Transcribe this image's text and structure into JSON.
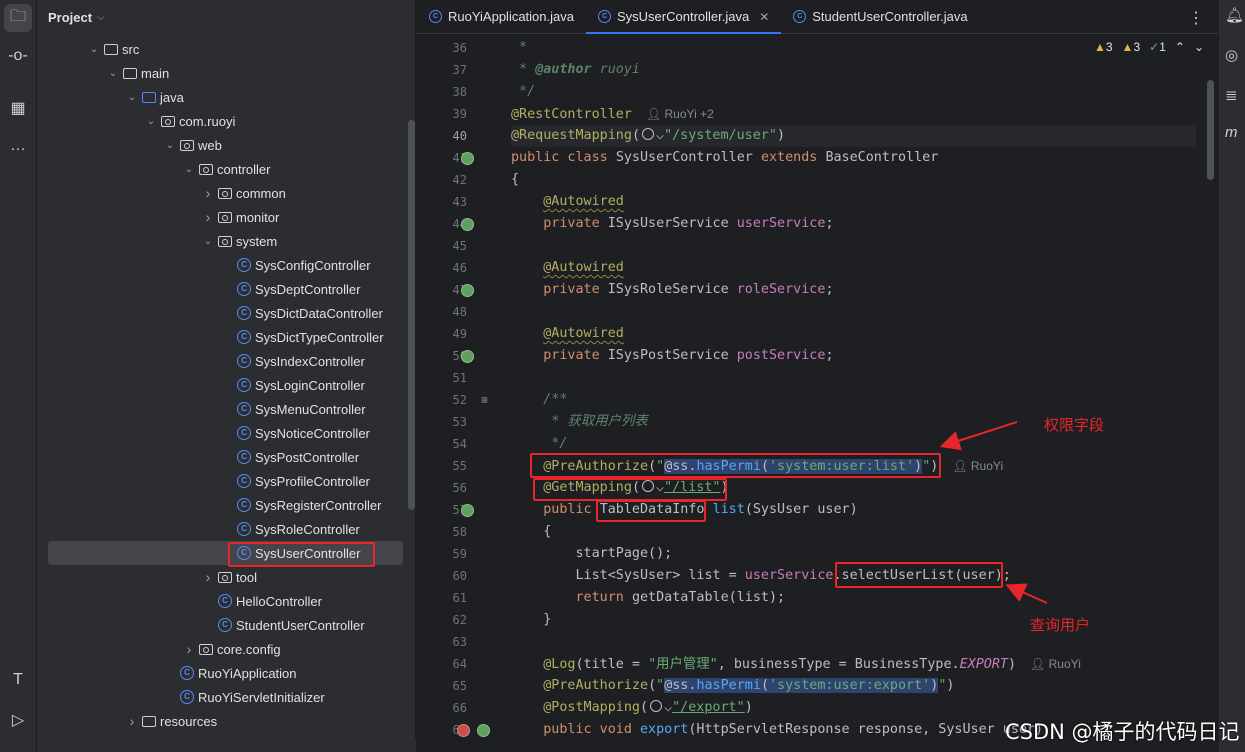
{
  "project_panel": {
    "title": "Project",
    "tree": [
      {
        "label": "src",
        "depth": 3,
        "expanded": true,
        "icon": "folder"
      },
      {
        "label": "main",
        "depth": 4,
        "expanded": true,
        "icon": "folder"
      },
      {
        "label": "java",
        "depth": 5,
        "expanded": true,
        "icon": "source-folder"
      },
      {
        "label": "com.ruoyi",
        "depth": 6,
        "expanded": true,
        "icon": "package"
      },
      {
        "label": "web",
        "depth": 7,
        "expanded": true,
        "icon": "package"
      },
      {
        "label": "controller",
        "depth": 8,
        "expanded": true,
        "icon": "package"
      },
      {
        "label": "common",
        "depth": 9,
        "expanded": false,
        "icon": "package"
      },
      {
        "label": "monitor",
        "depth": 9,
        "expanded": false,
        "icon": "package"
      },
      {
        "label": "system",
        "depth": 9,
        "expanded": true,
        "icon": "package"
      },
      {
        "label": "SysConfigController",
        "depth": 10,
        "icon": "class"
      },
      {
        "label": "SysDeptController",
        "depth": 10,
        "icon": "class"
      },
      {
        "label": "SysDictDataController",
        "depth": 10,
        "icon": "class"
      },
      {
        "label": "SysDictTypeController",
        "depth": 10,
        "icon": "class"
      },
      {
        "label": "SysIndexController",
        "depth": 10,
        "icon": "class"
      },
      {
        "label": "SysLoginController",
        "depth": 10,
        "icon": "class"
      },
      {
        "label": "SysMenuController",
        "depth": 10,
        "icon": "class"
      },
      {
        "label": "SysNoticeController",
        "depth": 10,
        "icon": "class"
      },
      {
        "label": "SysPostController",
        "depth": 10,
        "icon": "class"
      },
      {
        "label": "SysProfileController",
        "depth": 10,
        "icon": "class"
      },
      {
        "label": "SysRegisterController",
        "depth": 10,
        "icon": "class"
      },
      {
        "label": "SysRoleController",
        "depth": 10,
        "icon": "class"
      },
      {
        "label": "SysUserController",
        "depth": 10,
        "icon": "class",
        "selected": true
      },
      {
        "label": "tool",
        "depth": 9,
        "expanded": false,
        "icon": "package"
      },
      {
        "label": "HelloController",
        "depth": 9,
        "icon": "class"
      },
      {
        "label": "StudentUserController",
        "depth": 9,
        "icon": "class"
      },
      {
        "label": "core.config",
        "depth": 8,
        "expanded": false,
        "icon": "package"
      },
      {
        "label": "RuoYiApplication",
        "depth": 7,
        "icon": "class"
      },
      {
        "label": "RuoYiServletInitializer",
        "depth": 7,
        "icon": "class"
      },
      {
        "label": "resources",
        "depth": 5,
        "expanded": false,
        "icon": "folder"
      }
    ]
  },
  "tabs": [
    {
      "label": "RuoYiApplication.java",
      "active": false
    },
    {
      "label": "SysUserController.java",
      "active": true,
      "closable": true
    },
    {
      "label": "StudentUserController.java",
      "active": false
    }
  ],
  "inspections": {
    "warn1": "3",
    "warn2": "3",
    "ok": "1"
  },
  "line_numbers": [
    "36",
    "37",
    "38",
    "39",
    "40",
    "41",
    "42",
    "43",
    "44",
    "45",
    "46",
    "47",
    "48",
    "49",
    "50",
    "51",
    "52",
    "53",
    "54",
    "55",
    "56",
    "57",
    "58",
    "59",
    "60",
    "61",
    "62",
    "63",
    "64",
    "65",
    "66",
    "67"
  ],
  "author_hints": {
    "line39": "RuoYi +2",
    "line55": "RuoYi",
    "line64": "RuoYi"
  },
  "annotations": {
    "permission_label": "权限字段",
    "query_label": "查询用户",
    "watermark": "CSDN @橘子的代码日记"
  },
  "colors": {
    "annotation_red": "#e6262a",
    "accent": "#3574f0"
  }
}
